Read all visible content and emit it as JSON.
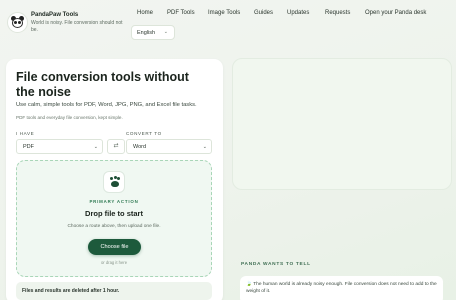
{
  "brand": {
    "name": "PandaPaw Tools",
    "tagline": "World is noisy. File conversion should not be."
  },
  "nav": {
    "items": [
      {
        "id": "home",
        "label": "Home"
      },
      {
        "id": "pdf-tools",
        "label": "PDF Tools"
      },
      {
        "id": "image-tools",
        "label": "Image Tools"
      },
      {
        "id": "guides",
        "label": "Guides"
      },
      {
        "id": "updates",
        "label": "Updates"
      },
      {
        "id": "requests",
        "label": "Requests"
      },
      {
        "id": "desk",
        "label": "Open your Panda desk"
      }
    ],
    "language": "English"
  },
  "hero": {
    "title": "File conversion tools without the noise",
    "subtitle": "Use calm, simple tools for PDF, Word, JPG, PNG, and Excel file tasks.",
    "note": "PDF tools and everyday file conversion, kept simple."
  },
  "converter": {
    "have_label": "I HAVE",
    "have_value": "PDF",
    "convert_label": "CONVERT TO",
    "convert_value": "Word",
    "swap_symbol": "⇄"
  },
  "dropzone": {
    "eyebrow": "PRIMARY ACTION",
    "title": "Drop file to start",
    "hint": "Choose a route above, then upload one file.",
    "button": "Choose file",
    "drag_note": "or drag it here"
  },
  "notice": "Files and results are deleted after 1 hour.",
  "panda_tell": {
    "label": "PANDA WANTS TO TELL",
    "icon": "🍃",
    "message": "The human world is already noisy enough. File conversion does not need to add to the weight of it."
  },
  "colors": {
    "accent": "#1d5a3c",
    "accent_light": "#2f7a53",
    "background": "#eef3ec"
  }
}
